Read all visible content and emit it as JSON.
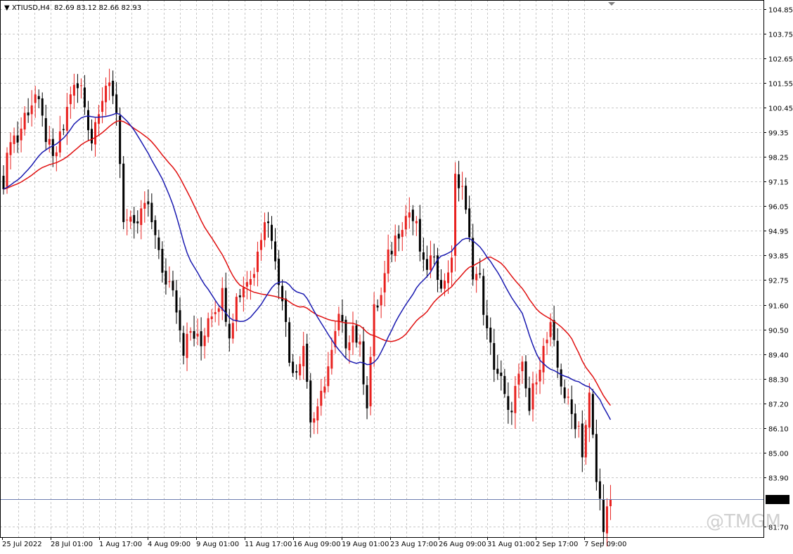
{
  "header": {
    "symbol_timeframe": "XTIUSD,H4",
    "ohlc": "82.69 83.12 82.66 82.93"
  },
  "watermark": "@TMGM",
  "colors": {
    "background": "#ffffff",
    "grid": "#c8c8c8",
    "bull_candle": "#e8211f",
    "bear_candle": "#000000",
    "ma_fast": "#1a1ab0",
    "ma_slow": "#e01010",
    "price_line": "#6f7fb0",
    "price_tag_bg": "#000000",
    "price_tag_text": "#ffffff"
  },
  "chart_data": {
    "type": "candlestick",
    "title": "XTIUSD,H4",
    "ylim": [
      81.24,
      105.26
    ],
    "grid": true,
    "y_ticks": [
      "104.85",
      "103.75",
      "102.65",
      "101.55",
      "100.45",
      "99.35",
      "98.25",
      "97.15",
      "96.05",
      "94.95",
      "93.85",
      "92.75",
      "91.60",
      "90.50",
      "89.40",
      "88.30",
      "87.20",
      "86.10",
      "85.00",
      "83.90",
      "81.70"
    ],
    "x_ticks": [
      "25 Jul 2022",
      "28 Jul 01:00",
      "1 Aug 17:00",
      "4 Aug 09:00",
      "9 Aug 01:00",
      "11 Aug 17:00",
      "16 Aug 09:00",
      "19 Aug 01:00",
      "23 Aug 17:00",
      "26 Aug 09:00",
      "31 Aug 01:00",
      "2 Sep 17:00",
      "7 Sep 09:00"
    ],
    "current_price": "82.93",
    "anchors": [
      [
        0,
        96.8
      ],
      [
        2,
        99.3
      ],
      [
        4,
        99.0
      ],
      [
        6,
        100.1
      ],
      [
        9,
        101.0
      ],
      [
        12,
        99.2
      ],
      [
        14,
        98.0
      ],
      [
        17,
        99.5
      ],
      [
        19,
        101.2
      ],
      [
        22,
        101.3
      ],
      [
        25,
        99.0
      ],
      [
        27,
        100.6
      ],
      [
        29,
        101.5
      ],
      [
        32,
        100.4
      ],
      [
        34,
        95.6
      ],
      [
        37,
        94.9
      ],
      [
        40,
        96.1
      ],
      [
        43,
        95.0
      ],
      [
        45,
        92.8
      ],
      [
        48,
        92.6
      ],
      [
        51,
        89.7
      ],
      [
        53,
        90.4
      ],
      [
        56,
        89.8
      ],
      [
        58,
        91.2
      ],
      [
        60,
        91.6
      ],
      [
        62,
        92.1
      ],
      [
        64,
        90.5
      ],
      [
        66,
        91.9
      ],
      [
        69,
        92.8
      ],
      [
        71,
        93.0
      ],
      [
        72,
        94.3
      ],
      [
        74,
        95.6
      ],
      [
        76,
        94.8
      ],
      [
        77,
        93.4
      ],
      [
        79,
        92.2
      ],
      [
        81,
        89.1
      ],
      [
        83,
        88.8
      ],
      [
        85,
        89.9
      ],
      [
        87,
        86.5
      ],
      [
        89,
        86.7
      ],
      [
        91,
        88.3
      ],
      [
        93,
        89.4
      ],
      [
        95,
        91.0
      ],
      [
        97,
        90.0
      ],
      [
        99,
        90.7
      ],
      [
        101,
        89.6
      ],
      [
        103,
        87.3
      ],
      [
        105,
        91.3
      ],
      [
        107,
        92.0
      ],
      [
        109,
        93.7
      ],
      [
        111,
        94.6
      ],
      [
        113,
        95.4
      ],
      [
        115,
        95.8
      ],
      [
        117,
        95.0
      ],
      [
        119,
        93.2
      ],
      [
        121,
        93.6
      ],
      [
        123,
        93.1
      ],
      [
        125,
        92.5
      ],
      [
        127,
        94.0
      ],
      [
        128,
        97.1
      ],
      [
        130,
        97.0
      ],
      [
        131,
        95.6
      ],
      [
        133,
        93.2
      ],
      [
        135,
        92.7
      ],
      [
        137,
        90.3
      ],
      [
        139,
        89.0
      ],
      [
        141,
        88.2
      ],
      [
        143,
        86.6
      ],
      [
        145,
        87.8
      ],
      [
        147,
        88.7
      ],
      [
        149,
        86.9
      ],
      [
        151,
        88.6
      ],
      [
        153,
        89.6
      ],
      [
        155,
        90.5
      ],
      [
        157,
        88.8
      ],
      [
        159,
        87.6
      ],
      [
        161,
        86.7
      ],
      [
        163,
        86.2
      ],
      [
        164,
        85.1
      ],
      [
        166,
        87.5
      ],
      [
        168,
        83.7
      ],
      [
        170,
        81.9
      ],
      [
        172,
        82.93
      ]
    ],
    "ma_fast_period": 20,
    "ma_slow_period": 34
  }
}
